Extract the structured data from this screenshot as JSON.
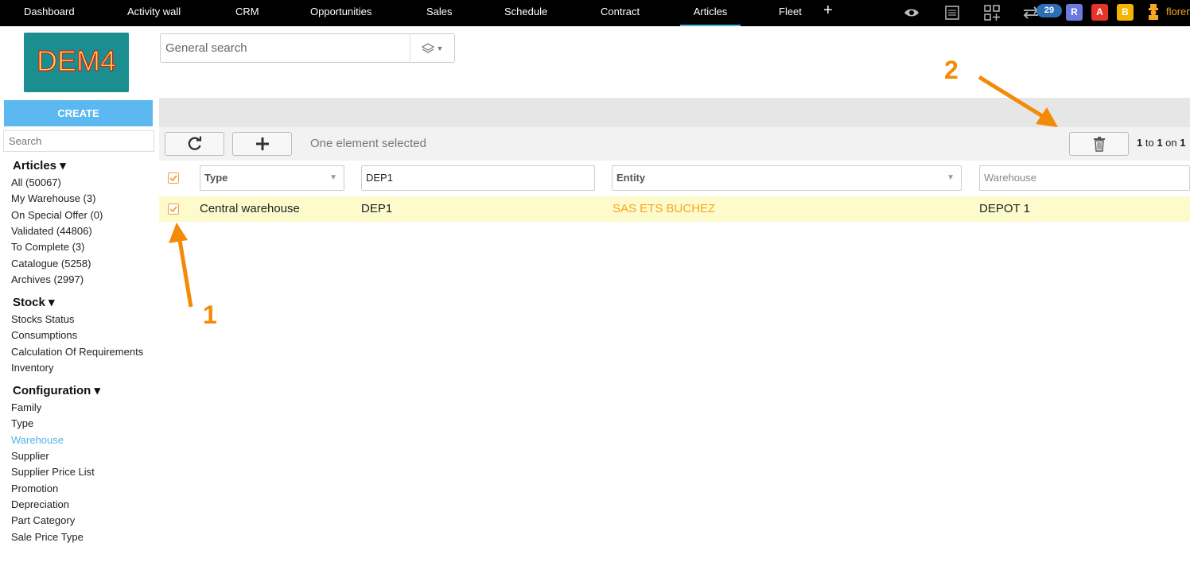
{
  "nav": {
    "items": [
      {
        "label": "Dashboard",
        "active": false
      },
      {
        "label": "Activity wall",
        "active": false
      },
      {
        "label": "CRM",
        "active": false
      },
      {
        "label": "Opportunities",
        "active": false
      },
      {
        "label": "Sales",
        "active": false
      },
      {
        "label": "Schedule",
        "active": false
      },
      {
        "label": "Contract",
        "active": false
      },
      {
        "label": "Articles",
        "active": true
      },
      {
        "label": "Fleet",
        "active": false
      }
    ],
    "add_label": "+",
    "notification_count": "29",
    "user_badges": [
      {
        "label": "R",
        "color": "#6c7ae0"
      },
      {
        "label": "A",
        "color": "#e8332a"
      },
      {
        "label": "B",
        "color": "#f5b400"
      }
    ],
    "user_name": "floren"
  },
  "logo": {
    "text": "DEM4"
  },
  "search": {
    "placeholder": "General search"
  },
  "sidebar": {
    "create_label": "CREATE",
    "search_placeholder": "Search",
    "sections": [
      {
        "title": "Articles ▾",
        "items": [
          {
            "label": "All (50067)"
          },
          {
            "label": "My Warehouse (3)"
          },
          {
            "label": "On Special Offer (0)"
          },
          {
            "label": "Validated (44806)"
          },
          {
            "label": "To Complete (3)"
          },
          {
            "label": "Catalogue (5258)"
          },
          {
            "label": "Archives (2997)"
          }
        ]
      },
      {
        "title": "Stock ▾",
        "items": [
          {
            "label": "Stocks Status"
          },
          {
            "label": "Consumptions"
          },
          {
            "label": "Calculation Of Requirements"
          },
          {
            "label": "Inventory"
          }
        ]
      },
      {
        "title": "Configuration ▾",
        "items": [
          {
            "label": "Family"
          },
          {
            "label": "Type"
          },
          {
            "label": "Warehouse",
            "active": true
          },
          {
            "label": "Supplier"
          },
          {
            "label": "Supplier Price List"
          },
          {
            "label": "Promotion"
          },
          {
            "label": "Depreciation"
          },
          {
            "label": "Part Category"
          },
          {
            "label": "Sale Price Type"
          }
        ]
      }
    ]
  },
  "toolbar": {
    "selection_text": "One element selected",
    "pager": {
      "from": "1",
      "to_word": " to ",
      "to": "1",
      "on_word": " on ",
      "total": "1"
    }
  },
  "filters": {
    "type": "Type",
    "code_value": "DEP1",
    "entity": "Entity",
    "warehouse_placeholder": "Warehouse"
  },
  "rows": [
    {
      "type": "Central warehouse",
      "code": "DEP1",
      "entity": "SAS ETS BUCHEZ",
      "warehouse": "DEPOT 1",
      "selected": true
    }
  ],
  "annotations": {
    "label_1": "1",
    "label_2": "2",
    "color": "#f58a07"
  }
}
